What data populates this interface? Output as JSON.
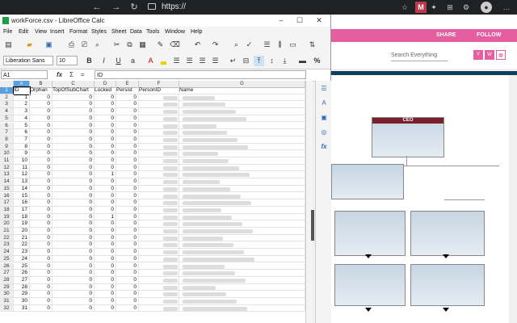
{
  "browser": {
    "url": "https://",
    "back": "←",
    "forward": "→",
    "reload": "↻",
    "extension_m": "M"
  },
  "app": {
    "share_label": "SHARE",
    "follow_label": "FOLLOW",
    "search_placeholder": "Search Everything",
    "icon1": "Y",
    "icon2": "W",
    "ceo_label": "CEO",
    "accent_color": "#e45fa0"
  },
  "calc": {
    "window_title": "workForce.csv - LibreOffice Calc",
    "menu": [
      "File",
      "Edit",
      "View",
      "Insert",
      "Format",
      "Styles",
      "Sheet",
      "Data",
      "Tools",
      "Window",
      "Help"
    ],
    "font_name": "Liberation Sans",
    "font_size": "10",
    "name_box": "A1",
    "formula_value": "ID",
    "columns": [
      "A",
      "B",
      "C",
      "D",
      "E",
      "F",
      "G"
    ],
    "headers": [
      "ID",
      "Orphan",
      "TopOfSubChart",
      "Locked",
      "Persist",
      "PersonID",
      "Name"
    ],
    "rows": [
      {
        "n": "2",
        "id": "1",
        "c": [
          "0",
          "0",
          "0",
          "0"
        ]
      },
      {
        "n": "3",
        "id": "2",
        "c": [
          "0",
          "0",
          "0",
          "0"
        ]
      },
      {
        "n": "4",
        "id": "3",
        "c": [
          "0",
          "0",
          "0",
          "0"
        ]
      },
      {
        "n": "5",
        "id": "4",
        "c": [
          "0",
          "0",
          "0",
          "0"
        ]
      },
      {
        "n": "6",
        "id": "5",
        "c": [
          "0",
          "0",
          "0",
          "0"
        ]
      },
      {
        "n": "7",
        "id": "6",
        "c": [
          "0",
          "0",
          "0",
          "0"
        ]
      },
      {
        "n": "8",
        "id": "7",
        "c": [
          "0",
          "0",
          "0",
          "0"
        ]
      },
      {
        "n": "9",
        "id": "8",
        "c": [
          "0",
          "0",
          "0",
          "0"
        ]
      },
      {
        "n": "10",
        "id": "9",
        "c": [
          "0",
          "0",
          "0",
          "0"
        ]
      },
      {
        "n": "11",
        "id": "10",
        "c": [
          "0",
          "0",
          "0",
          "0"
        ]
      },
      {
        "n": "12",
        "id": "11",
        "c": [
          "0",
          "0",
          "0",
          "0"
        ]
      },
      {
        "n": "13",
        "id": "12",
        "c": [
          "0",
          "0",
          "1",
          "0"
        ]
      },
      {
        "n": "14",
        "id": "13",
        "c": [
          "0",
          "0",
          "0",
          "0"
        ]
      },
      {
        "n": "15",
        "id": "14",
        "c": [
          "0",
          "0",
          "0",
          "0"
        ]
      },
      {
        "n": "16",
        "id": "15",
        "c": [
          "0",
          "0",
          "0",
          "0"
        ]
      },
      {
        "n": "17",
        "id": "16",
        "c": [
          "0",
          "0",
          "0",
          "0"
        ]
      },
      {
        "n": "18",
        "id": "17",
        "c": [
          "0",
          "0",
          "0",
          "0"
        ]
      },
      {
        "n": "19",
        "id": "18",
        "c": [
          "0",
          "0",
          "1",
          "0"
        ]
      },
      {
        "n": "20",
        "id": "19",
        "c": [
          "0",
          "0",
          "0",
          "0"
        ]
      },
      {
        "n": "21",
        "id": "20",
        "c": [
          "0",
          "0",
          "0",
          "0"
        ]
      },
      {
        "n": "22",
        "id": "21",
        "c": [
          "0",
          "0",
          "0",
          "0"
        ]
      },
      {
        "n": "23",
        "id": "22",
        "c": [
          "0",
          "0",
          "0",
          "0"
        ]
      },
      {
        "n": "24",
        "id": "23",
        "c": [
          "0",
          "0",
          "0",
          "0"
        ]
      },
      {
        "n": "25",
        "id": "24",
        "c": [
          "0",
          "0",
          "0",
          "0"
        ]
      },
      {
        "n": "26",
        "id": "25",
        "c": [
          "0",
          "0",
          "0",
          "0"
        ]
      },
      {
        "n": "27",
        "id": "26",
        "c": [
          "0",
          "0",
          "0",
          "0"
        ]
      },
      {
        "n": "28",
        "id": "27",
        "c": [
          "0",
          "0",
          "0",
          "0"
        ]
      },
      {
        "n": "29",
        "id": "28",
        "c": [
          "0",
          "0",
          "0",
          "0"
        ]
      },
      {
        "n": "30",
        "id": "29",
        "c": [
          "0",
          "0",
          "0",
          "0"
        ]
      },
      {
        "n": "31",
        "id": "30",
        "c": [
          "0",
          "0",
          "0",
          "0"
        ]
      },
      {
        "n": "32",
        "id": "31",
        "c": [
          "0",
          "0",
          "0",
          "0"
        ]
      }
    ]
  }
}
